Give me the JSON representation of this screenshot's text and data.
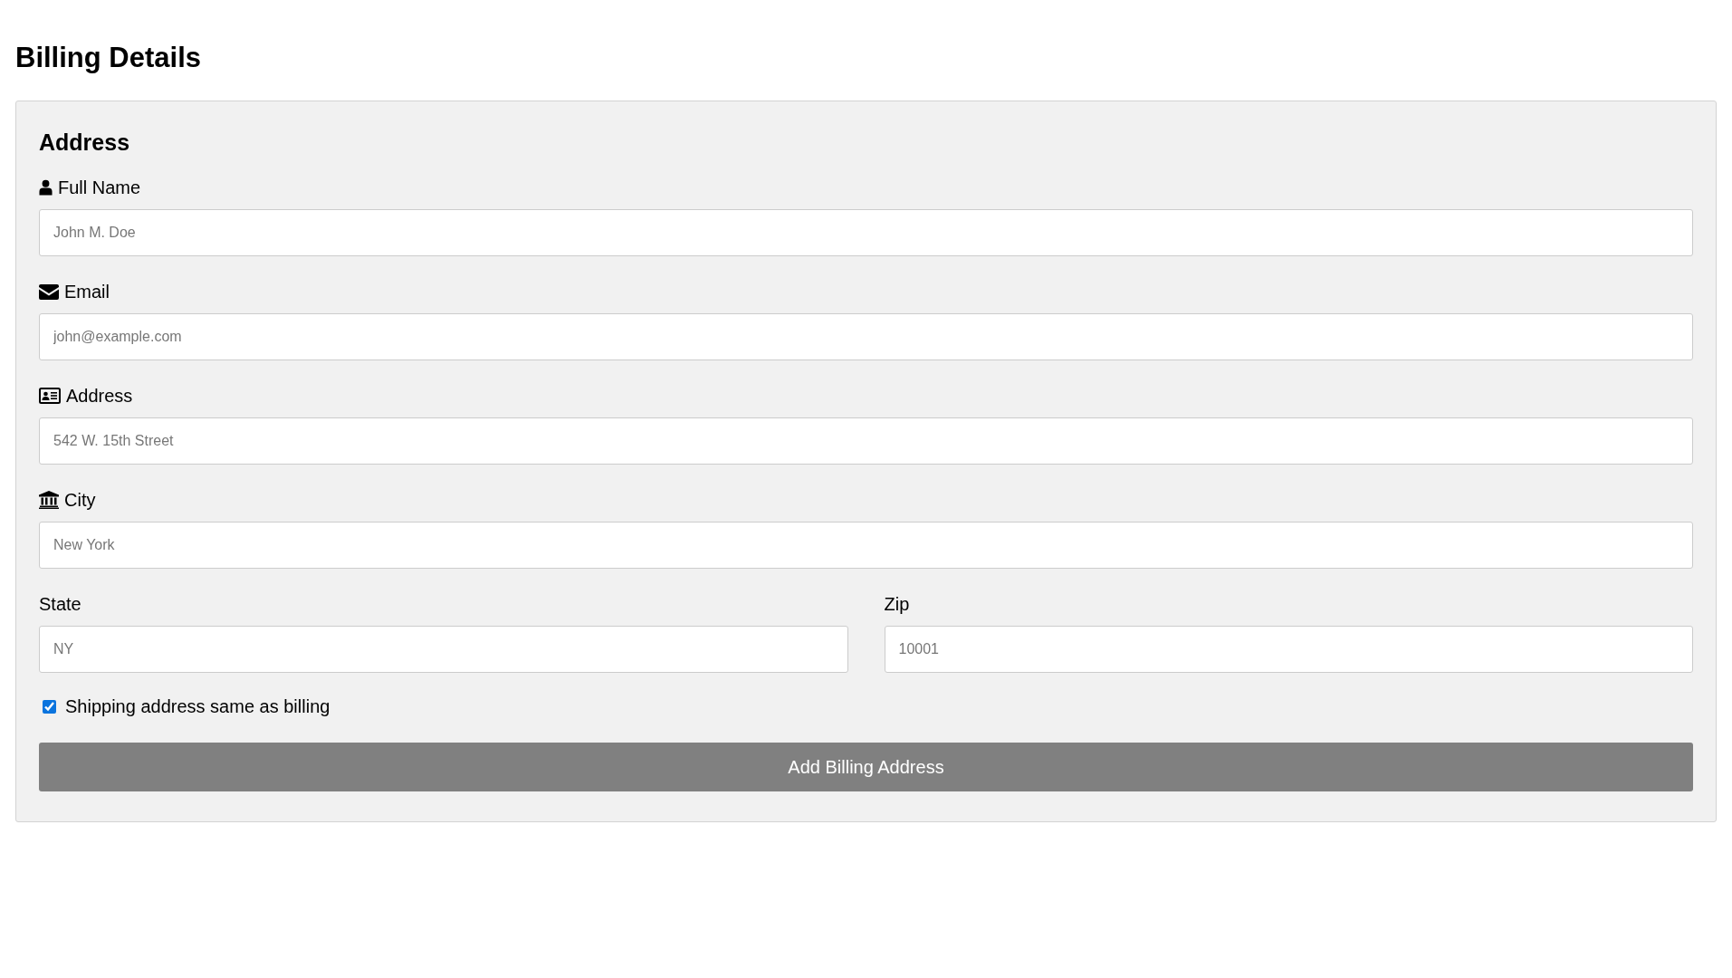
{
  "page_title": "Billing Details",
  "form": {
    "heading": "Address",
    "fields": [
      {
        "label": "Full Name",
        "placeholder": "John M. Doe"
      },
      {
        "label": "Email",
        "placeholder": "john@example.com"
      },
      {
        "label": "Address",
        "placeholder": "542 W. 15th Street"
      },
      {
        "label": "City",
        "placeholder": "New York"
      }
    ],
    "pair_fields": [
      {
        "label": "State",
        "placeholder": "NY"
      },
      {
        "label": "Zip",
        "placeholder": "10001"
      }
    ],
    "checkbox": {
      "label": "Shipping address same as billing",
      "checked": true
    },
    "submit_button": "Add Billing Address"
  }
}
